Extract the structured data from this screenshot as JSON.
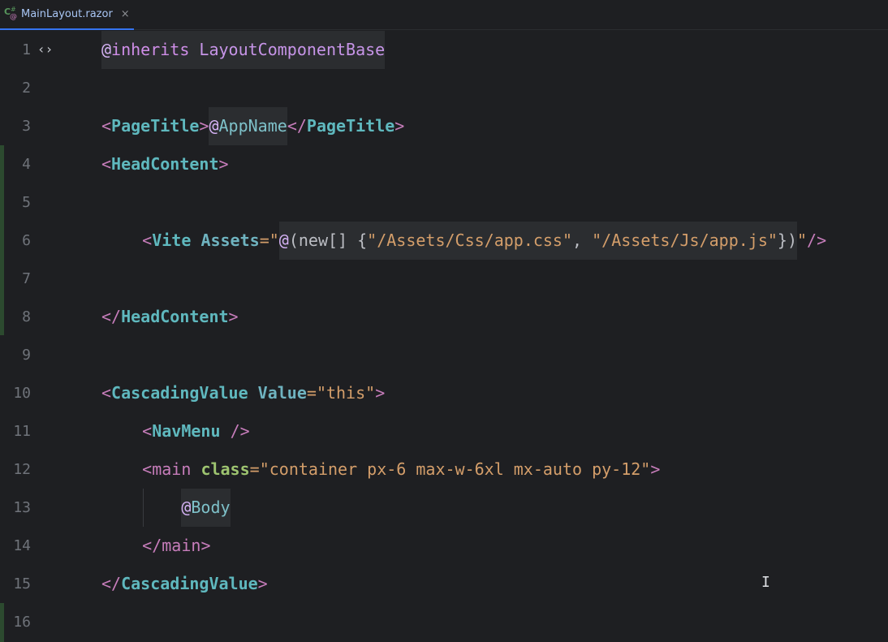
{
  "tab": {
    "filename": "MainLayout.razor",
    "close_glyph": "×",
    "icon": "csharp-razor-file-icon",
    "active_color": "#3574f0"
  },
  "gutter": {
    "line_numbers": [
      "1",
      "2",
      "3",
      "4",
      "5",
      "6",
      "7",
      "8",
      "9",
      "10",
      "11",
      "12",
      "13",
      "14",
      "15",
      "16"
    ],
    "fold_icon": "braces-fold-icon",
    "fold_glyph": "⟨⟩"
  },
  "code": {
    "line1": {
      "at": "@",
      "kw": "inherits",
      "space": " ",
      "id": "LayoutComponentBase"
    },
    "line3": {
      "open": "<",
      "tag": "PageTitle",
      "close": ">",
      "at": "@",
      "id": "AppName",
      "end_open": "</",
      "end_tag": "PageTitle",
      "end_close": ">"
    },
    "line4": {
      "open": "<",
      "tag": "HeadContent",
      "close": ">"
    },
    "line6": {
      "indent": "    ",
      "open": "<",
      "tag": "Vite",
      "sp": " ",
      "attr": "Assets",
      "eq": "=\"",
      "at": "@",
      "expr_open": "(new[] {",
      "str1": "\"/Assets/Css/app.css\"",
      "comma": ", ",
      "str2": "\"/Assets/Js/app.js\"",
      "expr_close": "})",
      "quote": "\"",
      "selfclose": "/>"
    },
    "line8": {
      "open": "</",
      "tag": "HeadContent",
      "close": ">"
    },
    "line10": {
      "open": "<",
      "tag": "CascadingValue",
      "sp": " ",
      "attr": "Value",
      "eq": "=",
      "val": "\"this\"",
      "close": ">"
    },
    "line11": {
      "indent": "    ",
      "open": "<",
      "tag": "NavMenu",
      "sp": " ",
      "selfclose": "/>"
    },
    "line12": {
      "indent": "    ",
      "open": "<",
      "tag": "main",
      "sp": " ",
      "attr": "class",
      "eq": "=",
      "val": "\"container px-6 max-w-6xl mx-auto py-12\"",
      "close": ">"
    },
    "line13": {
      "indent": "        ",
      "at": "@",
      "id": "Body"
    },
    "line14": {
      "indent": "    ",
      "open": "</",
      "tag": "main",
      "close": ">"
    },
    "line15": {
      "open": "</",
      "tag": "CascadingValue",
      "close": ">"
    }
  },
  "colors": {
    "background": "#1e1f22",
    "component": "#5fb8be",
    "string": "#d49e6a",
    "punctuation": "#c77dbb",
    "attribute": "#9ec470",
    "change_marker": "#2c4a2f"
  },
  "mouse_cursor": {
    "icon": "text-ibeam-cursor-icon",
    "glyph": "I"
  }
}
